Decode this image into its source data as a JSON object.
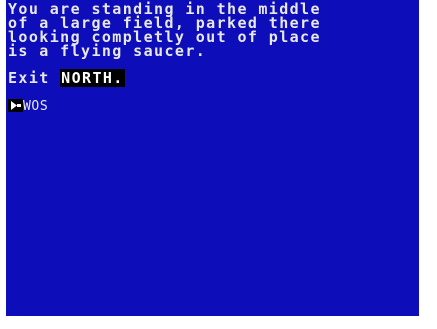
{
  "game": {
    "description_lines": [
      "You are standing in the middle",
      "of a large field, parked there",
      "looking completly out of place",
      "is a flying saucer."
    ],
    "exit_prefix": "Exit ",
    "exit_direction": "NORTH.",
    "command_input": "WOS",
    "cursor_icon": "prompt-cursor-icon"
  },
  "colors": {
    "background": "#0d0db9",
    "text": "#e8e8e8",
    "highlight_bg": "#000000",
    "highlight_text": "#ffffff"
  }
}
